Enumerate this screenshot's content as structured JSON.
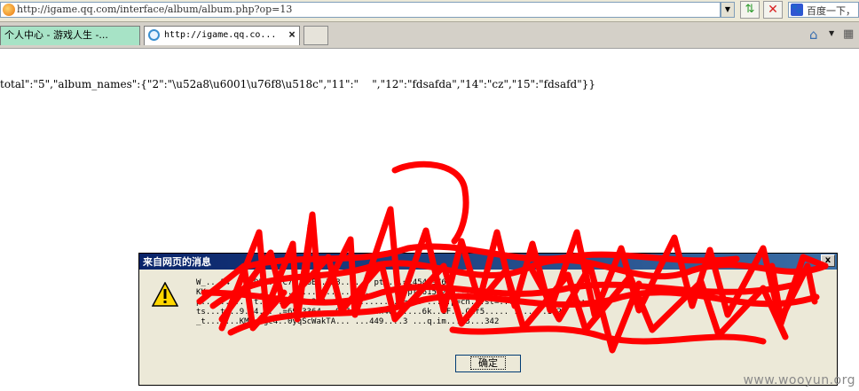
{
  "address_bar": {
    "url": "http://igame.qq.com/interface/album/album.php?op=13",
    "search_placeholder": "百度一下，"
  },
  "tabs": [
    {
      "label": "个人中心 - 游戏人生 -..."
    },
    {
      "label": "http://igame.qq.co..."
    }
  ],
  "page": {
    "json_text": "total\":\"5\",\"album_names\":{\"2\":\"\\u52a8\\u6001\\u76f8\\u518c\",\"11\":\"    \",\"12\":\"fdsafda\",\"14\":\"cz\",\"15\":\"fdsafd\"}}"
  },
  "dialog": {
    "title": "来自网页的消息",
    "close_glyph": "x",
    "message_lines": [
      "W_...14 ... DE6...C7..F6E..7B8...... pt2...=245449766",
      "KK=CH...... ... ..... ....... ...... ...... pt=6151205...",
      "p...... .. .t..=..d..02.3.0 ..0024...... .y=... ... .p=cn...st=.... .....d.....p;",
      "ts...t=..9.74... .=6913364...9.7 ...  4n4Q......6k..1F...Cif5..... ..... .1q2i",
      "_t...=...KM7..gc4..0yqScWakTA... ...449....3 ...q.im...13...342"
    ],
    "ok_label": "确定"
  },
  "watermark": "www.wooyun.org",
  "colors": {
    "scribble": "#ff0000",
    "tab_active_bg": "#a7e3c6",
    "title_bar": "#0a246a"
  }
}
